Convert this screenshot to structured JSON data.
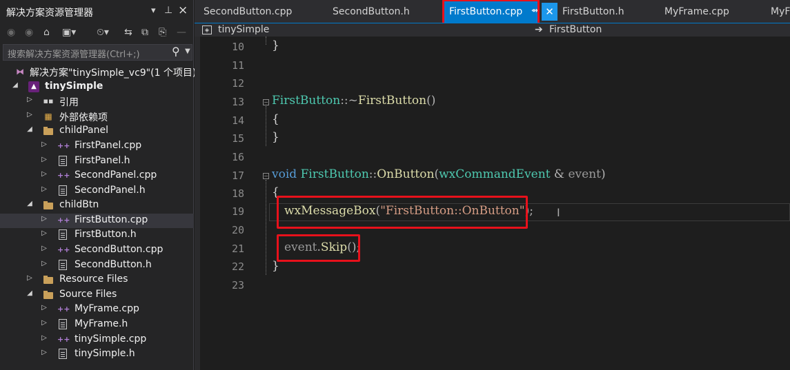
{
  "solution_explorer": {
    "title": "解决方案资源管理器",
    "search_placeholder": "搜索解决方案资源管理器(Ctrl+;)",
    "tree": [
      {
        "label": "解决方案\"tinySimple_vc9\"(1 个项目)",
        "icon": "solution-icon"
      },
      {
        "label": "tinySimple",
        "icon": "project-icon",
        "bold": true
      },
      {
        "label": "引用",
        "icon": "references-icon"
      },
      {
        "label": "外部依赖项",
        "icon": "external-deps-icon"
      },
      {
        "label": "childPanel",
        "icon": "filter-folder-icon"
      },
      {
        "label": "FirstPanel.cpp",
        "icon": "cpp-file-icon"
      },
      {
        "label": "FirstPanel.h",
        "icon": "header-file-icon"
      },
      {
        "label": "SecondPanel.cpp",
        "icon": "cpp-file-icon"
      },
      {
        "label": "SecondPanel.h",
        "icon": "header-file-icon"
      },
      {
        "label": "childBtn",
        "icon": "filter-folder-icon"
      },
      {
        "label": "FirstButton.cpp",
        "icon": "cpp-file-icon",
        "selected": true
      },
      {
        "label": "FirstButton.h",
        "icon": "header-file-icon"
      },
      {
        "label": "SecondButton.cpp",
        "icon": "cpp-file-icon"
      },
      {
        "label": "SecondButton.h",
        "icon": "header-file-icon"
      },
      {
        "label": "Resource Files",
        "icon": "filter-folder-icon"
      },
      {
        "label": "Source Files",
        "icon": "filter-folder-icon"
      },
      {
        "label": "MyFrame.cpp",
        "icon": "cpp-file-icon"
      },
      {
        "label": "MyFrame.h",
        "icon": "header-file-icon"
      },
      {
        "label": "tinySimple.cpp",
        "icon": "cpp-file-icon"
      },
      {
        "label": "tinySimple.h",
        "icon": "header-file-icon"
      }
    ]
  },
  "editor": {
    "tabs": [
      {
        "label": "SecondButton.cpp"
      },
      {
        "label": "SecondButton.h"
      },
      {
        "label": "FirstButton.cpp",
        "active": true
      },
      {
        "label": "FirstButton.h"
      },
      {
        "label": "MyFrame.cpp"
      },
      {
        "label": "MyFr"
      }
    ],
    "nav_left": "tinySimple",
    "nav_right": "FirstButton",
    "line_numbers": [
      "10",
      "11",
      "12",
      "13",
      "14",
      "15",
      "16",
      "17",
      "18",
      "19",
      "20",
      "21",
      "22",
      "23"
    ],
    "code": {
      "l10": "}",
      "l13_class": "FirstButton",
      "l13_sep": "::~",
      "l13_fn": "FirstButton",
      "l13_paren": "()",
      "l14": "{",
      "l15": "}",
      "l17_void": "void",
      "l17_class": "FirstButton",
      "l17_sep": "::",
      "l17_fn": "OnButton",
      "l17_open": "(",
      "l17_type": "wxCommandEvent",
      "l17_amp": " & ",
      "l17_param": "event",
      "l17_close": ")",
      "l18": "{",
      "l19_fn": "wxMessageBox",
      "l19_open": "(",
      "l19_str": "\"FirstButton::OnButton\"",
      "l19_close": ");",
      "l21_obj": "event",
      "l21_dot": ".",
      "l21_fn": "Skip",
      "l21_end": "();",
      "l22": "}"
    }
  },
  "colors": {
    "accent": "#007acc",
    "highlight_box": "#e8111b",
    "keyword": "#569cd6",
    "type": "#4ec9b0",
    "string": "#d69d85"
  }
}
